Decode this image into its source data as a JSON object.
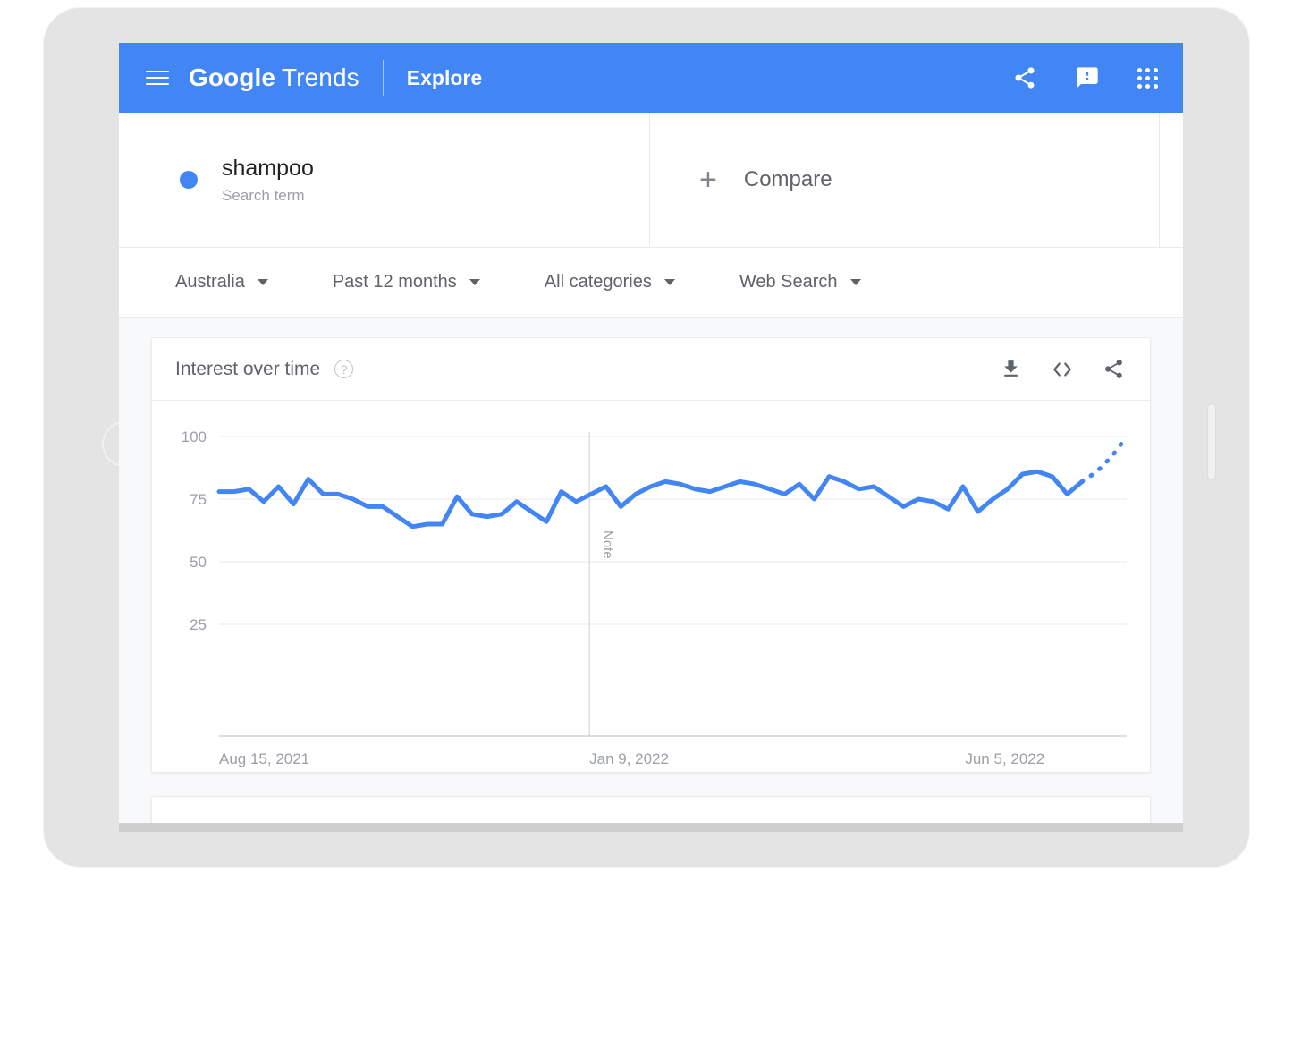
{
  "appbar": {
    "menu_icon": "hamburger-menu-icon",
    "brand_google": "Google",
    "brand_trends": "Trends",
    "explore_label": "Explore",
    "share_icon": "share-icon",
    "feedback_icon": "feedback-icon",
    "apps_icon": "apps-grid-icon",
    "background_color": "#4285f4"
  },
  "search": {
    "term": "shampoo",
    "term_type": "Search term",
    "term_color": "#4285f4",
    "compare_label": "Compare",
    "compare_icon": "plus-icon"
  },
  "filters": [
    {
      "label": "Australia",
      "icon": "chevron-down-icon"
    },
    {
      "label": "Past 12 months",
      "icon": "chevron-down-icon"
    },
    {
      "label": "All categories",
      "icon": "chevron-down-icon"
    },
    {
      "label": "Web Search",
      "icon": "chevron-down-icon"
    }
  ],
  "interest_card": {
    "title": "Interest over time",
    "help_icon": "help-circle-icon",
    "download_icon": "download-icon",
    "embed_icon": "embed-code-icon",
    "share_icon": "share-icon"
  },
  "chart_data": {
    "type": "line",
    "title": "Interest over time",
    "series": [
      {
        "name": "shampoo",
        "color": "#4285f4",
        "values": [
          78,
          78,
          79,
          74,
          80,
          73,
          83,
          77,
          77,
          75,
          72,
          72,
          68,
          64,
          65,
          65,
          76,
          69,
          68,
          69,
          74,
          70,
          66,
          78,
          74,
          77,
          80,
          72,
          77,
          80,
          82,
          81,
          79,
          78,
          80,
          82,
          81,
          79,
          77,
          81,
          75,
          84,
          82,
          79,
          80,
          76,
          72,
          75,
          74,
          71,
          80,
          70,
          75,
          79,
          85,
          86,
          84,
          77,
          82
        ],
        "forecast_values": [
          86,
          92,
          100
        ],
        "forecast_style": "dotted"
      }
    ],
    "ylabel": "",
    "xlabel": "",
    "ylim": [
      0,
      100
    ],
    "yticks": [
      25,
      50,
      75,
      100
    ],
    "xtick_labels": [
      "Aug 15, 2021",
      "Jan 9, 2022",
      "Jun 5, 2022"
    ],
    "xtick_positions": [
      0,
      0.408,
      0.822
    ],
    "grid": true,
    "legend": "none",
    "annotation": {
      "label": "Note",
      "x_position": 0.408,
      "orientation": "vertical"
    }
  }
}
